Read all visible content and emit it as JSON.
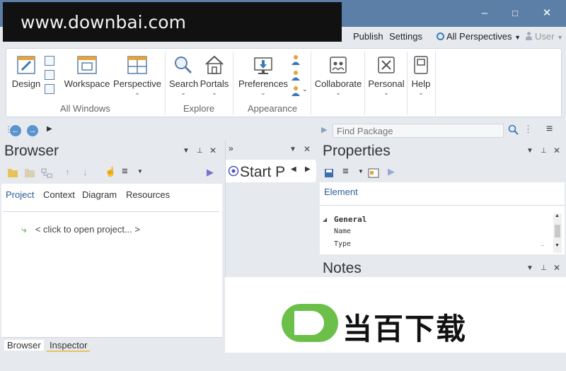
{
  "watermark": "www.downbai.com",
  "menu": {
    "publish": "Publish",
    "settings": "Settings",
    "perspectives": "All Perspectives",
    "user": "User"
  },
  "ribbon": {
    "design": "Design",
    "workspace": "Workspace",
    "perspective": "Perspective",
    "all_windows": "All Windows",
    "search": "Search",
    "portals": "Portals",
    "explore": "Explore",
    "preferences": "Preferences",
    "appearance": "Appearance",
    "collaborate": "Collaborate",
    "personal": "Personal",
    "help": "Help"
  },
  "nav": {
    "find_placeholder": "Find Package"
  },
  "browser": {
    "title": "Browser",
    "tabs": [
      "Project",
      "Context",
      "Diagram",
      "Resources"
    ],
    "tree_item": "< click to open project... >",
    "bottom_tabs": [
      "Browser",
      "Inspector"
    ]
  },
  "start": {
    "title": "Start P"
  },
  "properties": {
    "title": "Properties",
    "tab": "Element",
    "group": "General",
    "rows": [
      "Name",
      "Type"
    ],
    "type_value": ".."
  },
  "notes": {
    "title": "Notes"
  },
  "logo": {
    "text": "当百下载"
  },
  "colors": {
    "titlebar": "#5b7fa7",
    "accent": "#3b78b8",
    "logo_green": "#6cc04a"
  }
}
